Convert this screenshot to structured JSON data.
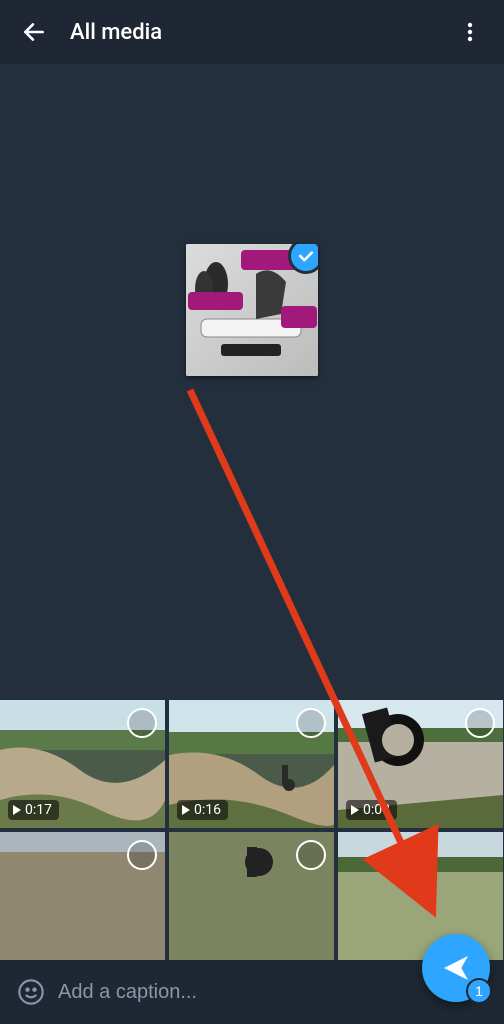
{
  "header": {
    "title": "All media"
  },
  "preview": {
    "selected": true
  },
  "gallery": {
    "row1": [
      {
        "duration": "0:17"
      },
      {
        "duration": "0:16"
      },
      {
        "duration": "0:08"
      }
    ]
  },
  "caption": {
    "placeholder": "Add a caption..."
  },
  "send": {
    "count": "1"
  },
  "colors": {
    "accent": "#2ea6ff",
    "bg": "#242f3d",
    "bar": "#1e2733"
  }
}
